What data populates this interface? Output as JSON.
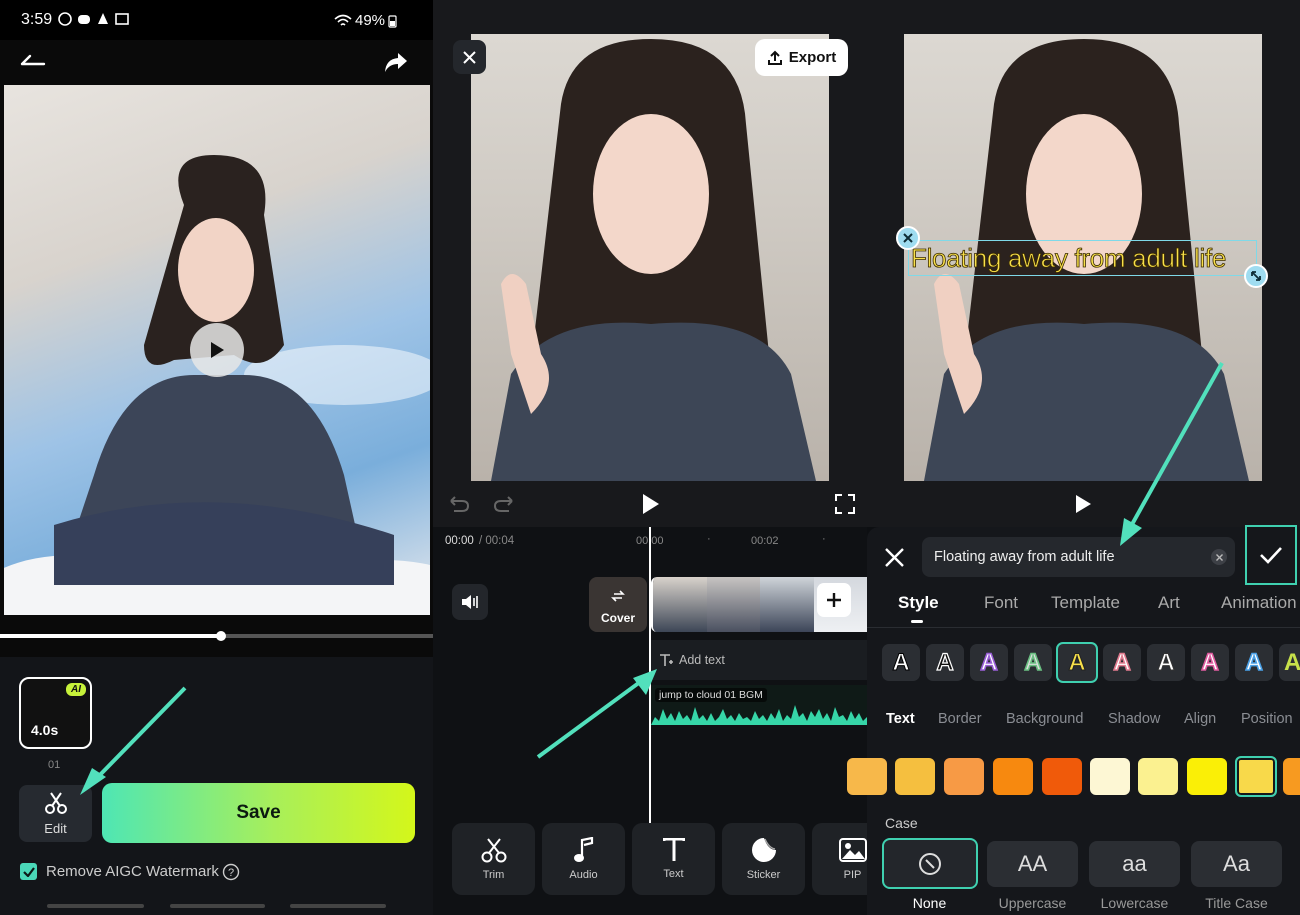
{
  "status_bar": {
    "time": "3:59",
    "battery": "49%"
  },
  "editor_left": {
    "clip": {
      "duration": "4.0s",
      "ai_badge": "AI",
      "index": "01"
    },
    "edit_label": "Edit",
    "save_label": "Save",
    "watermark_label": "Remove AIGC Watermark",
    "watermark_checked": true,
    "playback_progress": 0.51
  },
  "editor_middle": {
    "export_label": "Export",
    "time_current": "00:00",
    "time_total": "/ 00:04",
    "ruler": [
      "00:00",
      "00:02"
    ],
    "cover_label": "Cover",
    "add_text_label": "Add text",
    "audio_label": "jump to cloud 01 BGM",
    "tools": [
      {
        "label": "Trim",
        "icon": "scissors-icon"
      },
      {
        "label": "Audio",
        "icon": "music-note-icon"
      },
      {
        "label": "Text",
        "icon": "text-icon"
      },
      {
        "label": "Sticker",
        "icon": "sticker-icon"
      },
      {
        "label": "PIP",
        "icon": "image-icon"
      }
    ]
  },
  "editor_right": {
    "overlay_text": "Floating away from adult life",
    "input_value": "Floating away from adult life",
    "tabs": [
      "Style",
      "Font",
      "Template",
      "Art",
      "Animation"
    ],
    "active_tab": "Style",
    "style_glyph": "A",
    "subtabs": [
      "Text",
      "Border",
      "Background",
      "Shadow",
      "Align",
      "Position"
    ],
    "active_subtab": "Text",
    "colors": [
      "#f7b84a",
      "#f5bf3f",
      "#f79a45",
      "#f7890f",
      "#f05a0a",
      "#fdf7d4",
      "#fbf190",
      "#faef06",
      "#f8d94a",
      "#f79a20"
    ],
    "selected_color": "#f8d94a",
    "case_title": "Case",
    "case_options": [
      {
        "glyph": "",
        "label": "None"
      },
      {
        "glyph": "AA",
        "label": "Uppercase"
      },
      {
        "glyph": "aa",
        "label": "Lowercase"
      },
      {
        "glyph": "Aa",
        "label": "Title Case"
      }
    ]
  }
}
